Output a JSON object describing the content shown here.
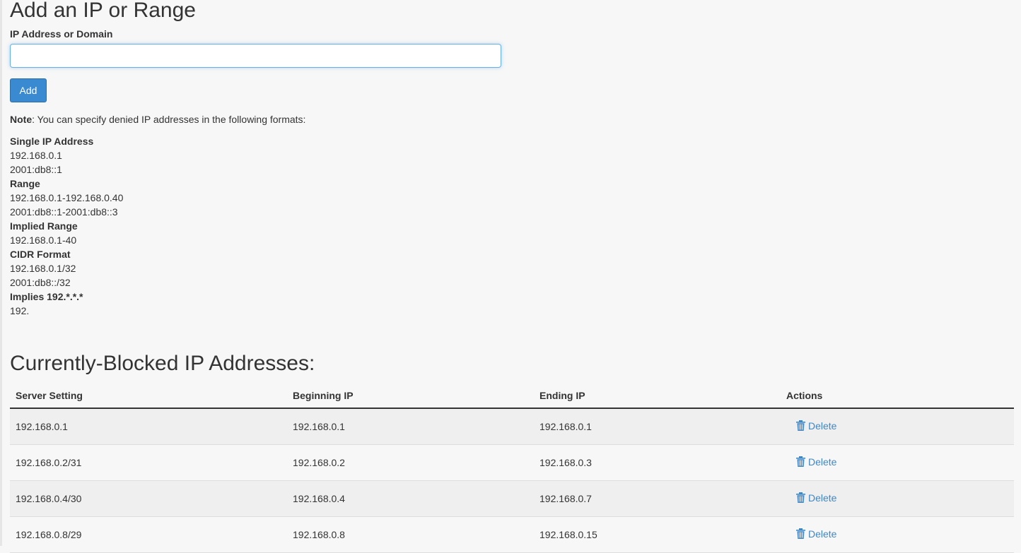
{
  "add_section": {
    "title": "Add an IP or Range",
    "field_label": "IP Address or Domain",
    "input_value": "",
    "input_placeholder": "",
    "add_button_label": "Add"
  },
  "note": {
    "label": "Note",
    "text": ": You can specify denied IP addresses in the following formats:"
  },
  "formats": [
    {
      "heading": "Single IP Address",
      "examples": [
        "192.168.0.1",
        "2001:db8::1"
      ]
    },
    {
      "heading": "Range",
      "examples": [
        "192.168.0.1-192.168.0.40",
        "2001:db8::1-2001:db8::3"
      ]
    },
    {
      "heading": "Implied Range",
      "examples": [
        "192.168.0.1-40"
      ]
    },
    {
      "heading": "CIDR Format",
      "examples": [
        "192.168.0.1/32",
        "2001:db8::/32"
      ]
    },
    {
      "heading": "Implies 192.*.*.*",
      "examples": [
        "192."
      ]
    }
  ],
  "blocked": {
    "title": "Currently-Blocked IP Addresses:",
    "columns": [
      "Server Setting",
      "Beginning IP",
      "Ending IP",
      "Actions"
    ],
    "rows": [
      {
        "setting": "192.168.0.1",
        "begin": "192.168.0.1",
        "end": "192.168.0.1",
        "action": "Delete"
      },
      {
        "setting": "192.168.0.2/31",
        "begin": "192.168.0.2",
        "end": "192.168.0.3",
        "action": "Delete"
      },
      {
        "setting": "192.168.0.4/30",
        "begin": "192.168.0.4",
        "end": "192.168.0.7",
        "action": "Delete"
      },
      {
        "setting": "192.168.0.8/29",
        "begin": "192.168.0.8",
        "end": "192.168.0.15",
        "action": "Delete"
      }
    ]
  },
  "colors": {
    "link": "#3f87c5",
    "button": "#3a8ad1",
    "input_focus_border": "#66afe9",
    "row_stripe": "#efefef"
  }
}
